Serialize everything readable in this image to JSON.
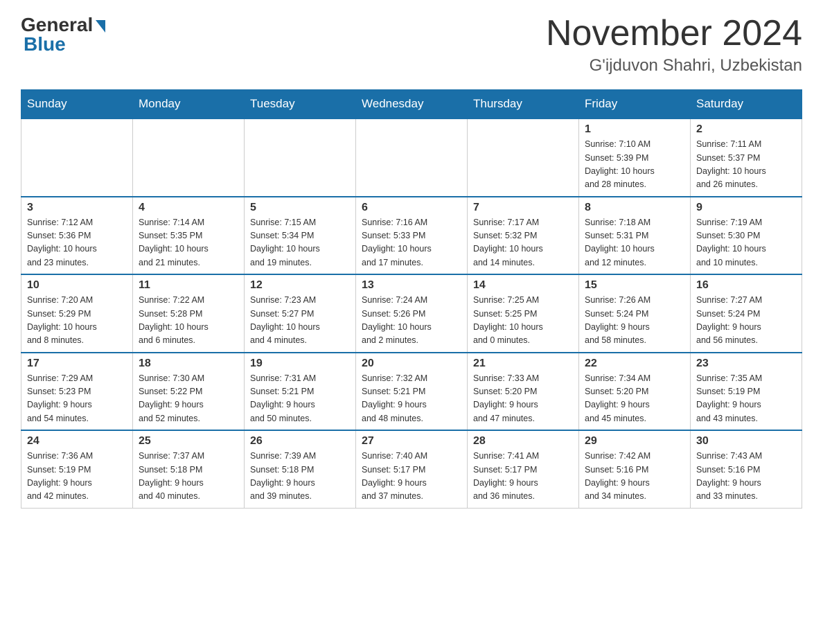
{
  "header": {
    "logo_general": "General",
    "logo_blue": "Blue",
    "month_title": "November 2024",
    "location": "G'ijduvon Shahri, Uzbekistan"
  },
  "days_of_week": [
    "Sunday",
    "Monday",
    "Tuesday",
    "Wednesday",
    "Thursday",
    "Friday",
    "Saturday"
  ],
  "weeks": [
    {
      "days": [
        {
          "num": "",
          "info": ""
        },
        {
          "num": "",
          "info": ""
        },
        {
          "num": "",
          "info": ""
        },
        {
          "num": "",
          "info": ""
        },
        {
          "num": "",
          "info": ""
        },
        {
          "num": "1",
          "info": "Sunrise: 7:10 AM\nSunset: 5:39 PM\nDaylight: 10 hours\nand 28 minutes."
        },
        {
          "num": "2",
          "info": "Sunrise: 7:11 AM\nSunset: 5:37 PM\nDaylight: 10 hours\nand 26 minutes."
        }
      ]
    },
    {
      "days": [
        {
          "num": "3",
          "info": "Sunrise: 7:12 AM\nSunset: 5:36 PM\nDaylight: 10 hours\nand 23 minutes."
        },
        {
          "num": "4",
          "info": "Sunrise: 7:14 AM\nSunset: 5:35 PM\nDaylight: 10 hours\nand 21 minutes."
        },
        {
          "num": "5",
          "info": "Sunrise: 7:15 AM\nSunset: 5:34 PM\nDaylight: 10 hours\nand 19 minutes."
        },
        {
          "num": "6",
          "info": "Sunrise: 7:16 AM\nSunset: 5:33 PM\nDaylight: 10 hours\nand 17 minutes."
        },
        {
          "num": "7",
          "info": "Sunrise: 7:17 AM\nSunset: 5:32 PM\nDaylight: 10 hours\nand 14 minutes."
        },
        {
          "num": "8",
          "info": "Sunrise: 7:18 AM\nSunset: 5:31 PM\nDaylight: 10 hours\nand 12 minutes."
        },
        {
          "num": "9",
          "info": "Sunrise: 7:19 AM\nSunset: 5:30 PM\nDaylight: 10 hours\nand 10 minutes."
        }
      ]
    },
    {
      "days": [
        {
          "num": "10",
          "info": "Sunrise: 7:20 AM\nSunset: 5:29 PM\nDaylight: 10 hours\nand 8 minutes."
        },
        {
          "num": "11",
          "info": "Sunrise: 7:22 AM\nSunset: 5:28 PM\nDaylight: 10 hours\nand 6 minutes."
        },
        {
          "num": "12",
          "info": "Sunrise: 7:23 AM\nSunset: 5:27 PM\nDaylight: 10 hours\nand 4 minutes."
        },
        {
          "num": "13",
          "info": "Sunrise: 7:24 AM\nSunset: 5:26 PM\nDaylight: 10 hours\nand 2 minutes."
        },
        {
          "num": "14",
          "info": "Sunrise: 7:25 AM\nSunset: 5:25 PM\nDaylight: 10 hours\nand 0 minutes."
        },
        {
          "num": "15",
          "info": "Sunrise: 7:26 AM\nSunset: 5:24 PM\nDaylight: 9 hours\nand 58 minutes."
        },
        {
          "num": "16",
          "info": "Sunrise: 7:27 AM\nSunset: 5:24 PM\nDaylight: 9 hours\nand 56 minutes."
        }
      ]
    },
    {
      "days": [
        {
          "num": "17",
          "info": "Sunrise: 7:29 AM\nSunset: 5:23 PM\nDaylight: 9 hours\nand 54 minutes."
        },
        {
          "num": "18",
          "info": "Sunrise: 7:30 AM\nSunset: 5:22 PM\nDaylight: 9 hours\nand 52 minutes."
        },
        {
          "num": "19",
          "info": "Sunrise: 7:31 AM\nSunset: 5:21 PM\nDaylight: 9 hours\nand 50 minutes."
        },
        {
          "num": "20",
          "info": "Sunrise: 7:32 AM\nSunset: 5:21 PM\nDaylight: 9 hours\nand 48 minutes."
        },
        {
          "num": "21",
          "info": "Sunrise: 7:33 AM\nSunset: 5:20 PM\nDaylight: 9 hours\nand 47 minutes."
        },
        {
          "num": "22",
          "info": "Sunrise: 7:34 AM\nSunset: 5:20 PM\nDaylight: 9 hours\nand 45 minutes."
        },
        {
          "num": "23",
          "info": "Sunrise: 7:35 AM\nSunset: 5:19 PM\nDaylight: 9 hours\nand 43 minutes."
        }
      ]
    },
    {
      "days": [
        {
          "num": "24",
          "info": "Sunrise: 7:36 AM\nSunset: 5:19 PM\nDaylight: 9 hours\nand 42 minutes."
        },
        {
          "num": "25",
          "info": "Sunrise: 7:37 AM\nSunset: 5:18 PM\nDaylight: 9 hours\nand 40 minutes."
        },
        {
          "num": "26",
          "info": "Sunrise: 7:39 AM\nSunset: 5:18 PM\nDaylight: 9 hours\nand 39 minutes."
        },
        {
          "num": "27",
          "info": "Sunrise: 7:40 AM\nSunset: 5:17 PM\nDaylight: 9 hours\nand 37 minutes."
        },
        {
          "num": "28",
          "info": "Sunrise: 7:41 AM\nSunset: 5:17 PM\nDaylight: 9 hours\nand 36 minutes."
        },
        {
          "num": "29",
          "info": "Sunrise: 7:42 AM\nSunset: 5:16 PM\nDaylight: 9 hours\nand 34 minutes."
        },
        {
          "num": "30",
          "info": "Sunrise: 7:43 AM\nSunset: 5:16 PM\nDaylight: 9 hours\nand 33 minutes."
        }
      ]
    }
  ]
}
